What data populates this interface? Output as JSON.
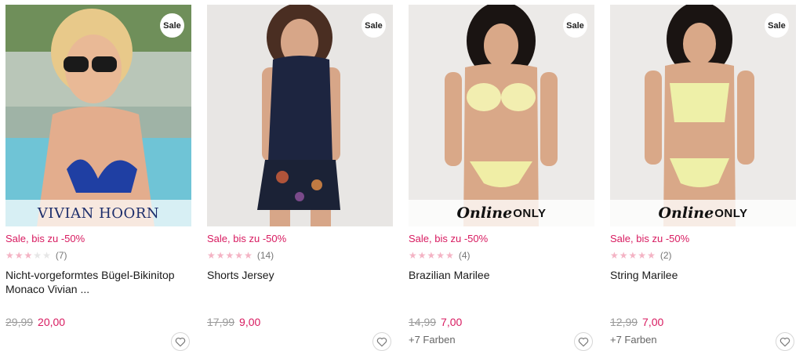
{
  "products": [
    {
      "badge": "Sale",
      "brand_banner": "VIVIAN HOORN",
      "promo": "Sale, bis zu -50%",
      "rating": 3,
      "reviews": "(7)",
      "title": "Nicht-vorgeformtes Bügel-Bikinitop Monaco Vivian ...",
      "old_price": "29,99",
      "new_price": "20,00",
      "colors": ""
    },
    {
      "badge": "Sale",
      "promo": "Sale, bis zu -50%",
      "rating": 5,
      "reviews": "(14)",
      "title": "Shorts Jersey",
      "old_price": "17,99",
      "new_price": "9,00",
      "colors": ""
    },
    {
      "badge": "Sale",
      "online_banner": {
        "word1": "Online",
        "word2": "ONLY"
      },
      "promo": "Sale, bis zu -50%",
      "rating": 5,
      "reviews": "(4)",
      "title": "Brazilian Marilee",
      "old_price": "14,99",
      "new_price": "7,00",
      "colors": "+7 Farben"
    },
    {
      "badge": "Sale",
      "online_banner": {
        "word1": "Online",
        "word2": "ONLY"
      },
      "promo": "Sale, bis zu -50%",
      "rating": 5,
      "reviews": "(2)",
      "title": "String Marilee",
      "old_price": "12,99",
      "new_price": "7,00",
      "colors": "+7 Farben"
    }
  ],
  "icons": {
    "wishlist": "heart-outline-icon",
    "star": "star-icon"
  },
  "colors": {
    "sale_accent": "#d81b60",
    "star_filled": "#f4b3c4",
    "star_empty": "#e6e6e6"
  }
}
